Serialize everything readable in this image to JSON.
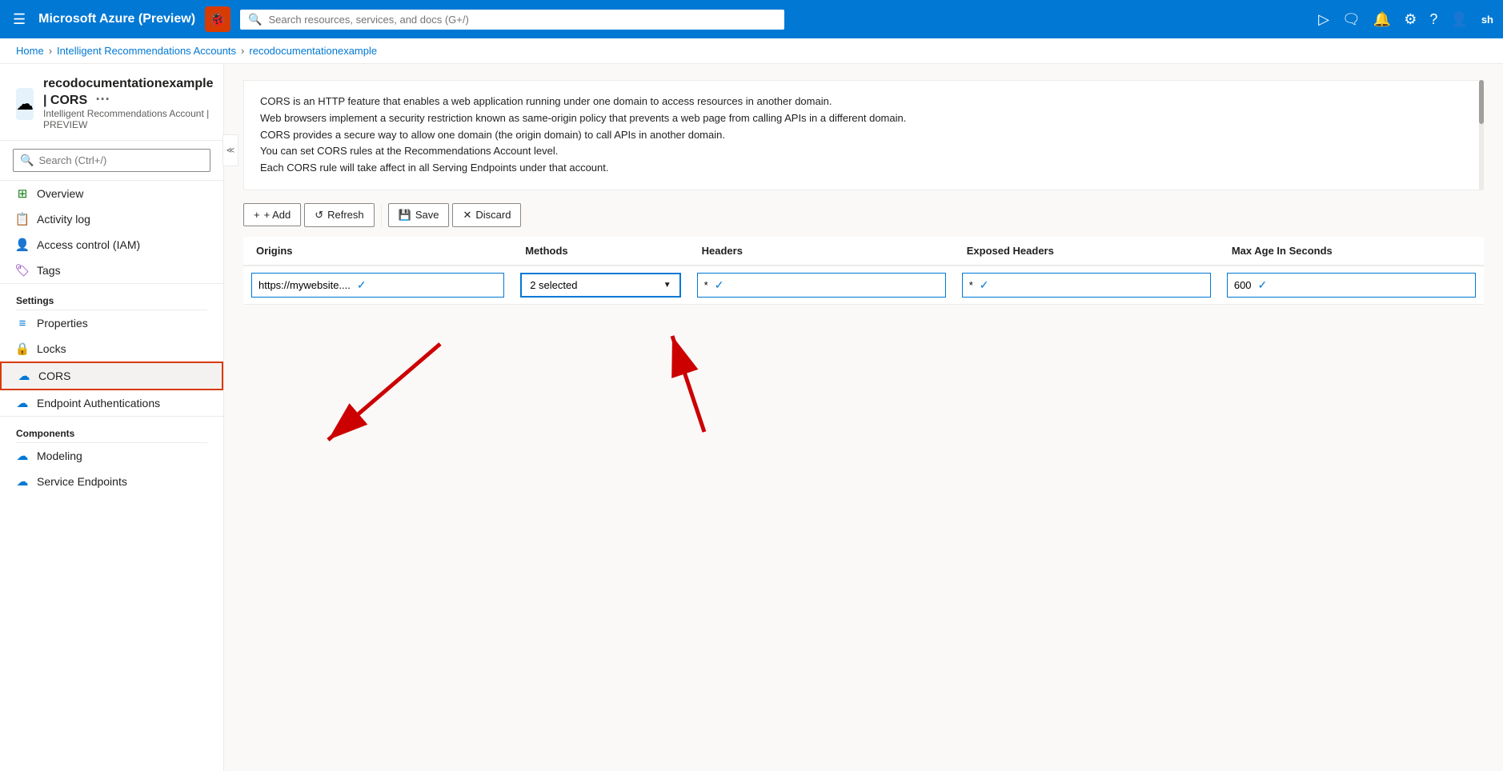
{
  "topnav": {
    "app_title": "Microsoft Azure (Preview)",
    "search_placeholder": "Search resources, services, and docs (G+/)",
    "bug_icon": "🐞",
    "user_abbr": "sh"
  },
  "breadcrumb": {
    "home": "Home",
    "accounts": "Intelligent Recommendations Accounts",
    "resource": "recodocumentationexample"
  },
  "resource_header": {
    "name": "recodocumentationexample",
    "divider": "|",
    "section": "CORS",
    "subtitle": "Intelligent Recommendations Account | PREVIEW"
  },
  "sidebar": {
    "search_placeholder": "Search (Ctrl+/)",
    "items": [
      {
        "label": "Overview",
        "icon": "⊞",
        "color": "#107c10"
      },
      {
        "label": "Activity log",
        "icon": "📋",
        "color": "#0078d4"
      },
      {
        "label": "Access control (IAM)",
        "icon": "👤",
        "color": "#0078d4"
      },
      {
        "label": "Tags",
        "icon": "🏷",
        "color": "#7719aa"
      }
    ],
    "sections": [
      {
        "label": "Settings",
        "items": [
          {
            "label": "Properties",
            "icon": "≡",
            "color": "#0078d4"
          },
          {
            "label": "Locks",
            "icon": "🔒",
            "color": "#0078d4"
          },
          {
            "label": "CORS",
            "icon": "☁",
            "color": "#0078d4",
            "active": true
          },
          {
            "label": "Endpoint Authentications",
            "icon": "☁",
            "color": "#0078d4"
          }
        ]
      },
      {
        "label": "Components",
        "items": [
          {
            "label": "Modeling",
            "icon": "☁",
            "color": "#0078d4"
          },
          {
            "label": "Service Endpoints",
            "icon": "☁",
            "color": "#0078d4"
          }
        ]
      }
    ]
  },
  "description": {
    "lines": [
      "CORS is an HTTP feature that enables a web application running under one domain to access resources in another domain.",
      "Web browsers implement a security restriction known as same-origin policy that prevents a web page from calling APIs in a different domain.",
      "CORS provides a secure way to allow one domain (the origin domain) to call APIs in another domain.",
      "You can set CORS rules at the Recommendations Account level.",
      "Each CORS rule will take affect in all Serving Endpoints under that account."
    ]
  },
  "toolbar": {
    "add_label": "+ Add",
    "refresh_label": "↺ Refresh",
    "save_label": "💾 Save",
    "discard_label": "✕ Discard"
  },
  "table": {
    "columns": [
      "Origins",
      "Methods",
      "Headers",
      "Exposed Headers",
      "Max Age In Seconds"
    ],
    "rows": [
      {
        "origins": "https://mywebsite....",
        "methods": "2 selected",
        "headers": "*",
        "exposed_headers": "*",
        "max_age": "600"
      }
    ]
  },
  "arrows": {
    "arrow1_label": "Red arrow pointing to CORS menu item",
    "arrow2_label": "Red arrow pointing to Methods dropdown"
  }
}
